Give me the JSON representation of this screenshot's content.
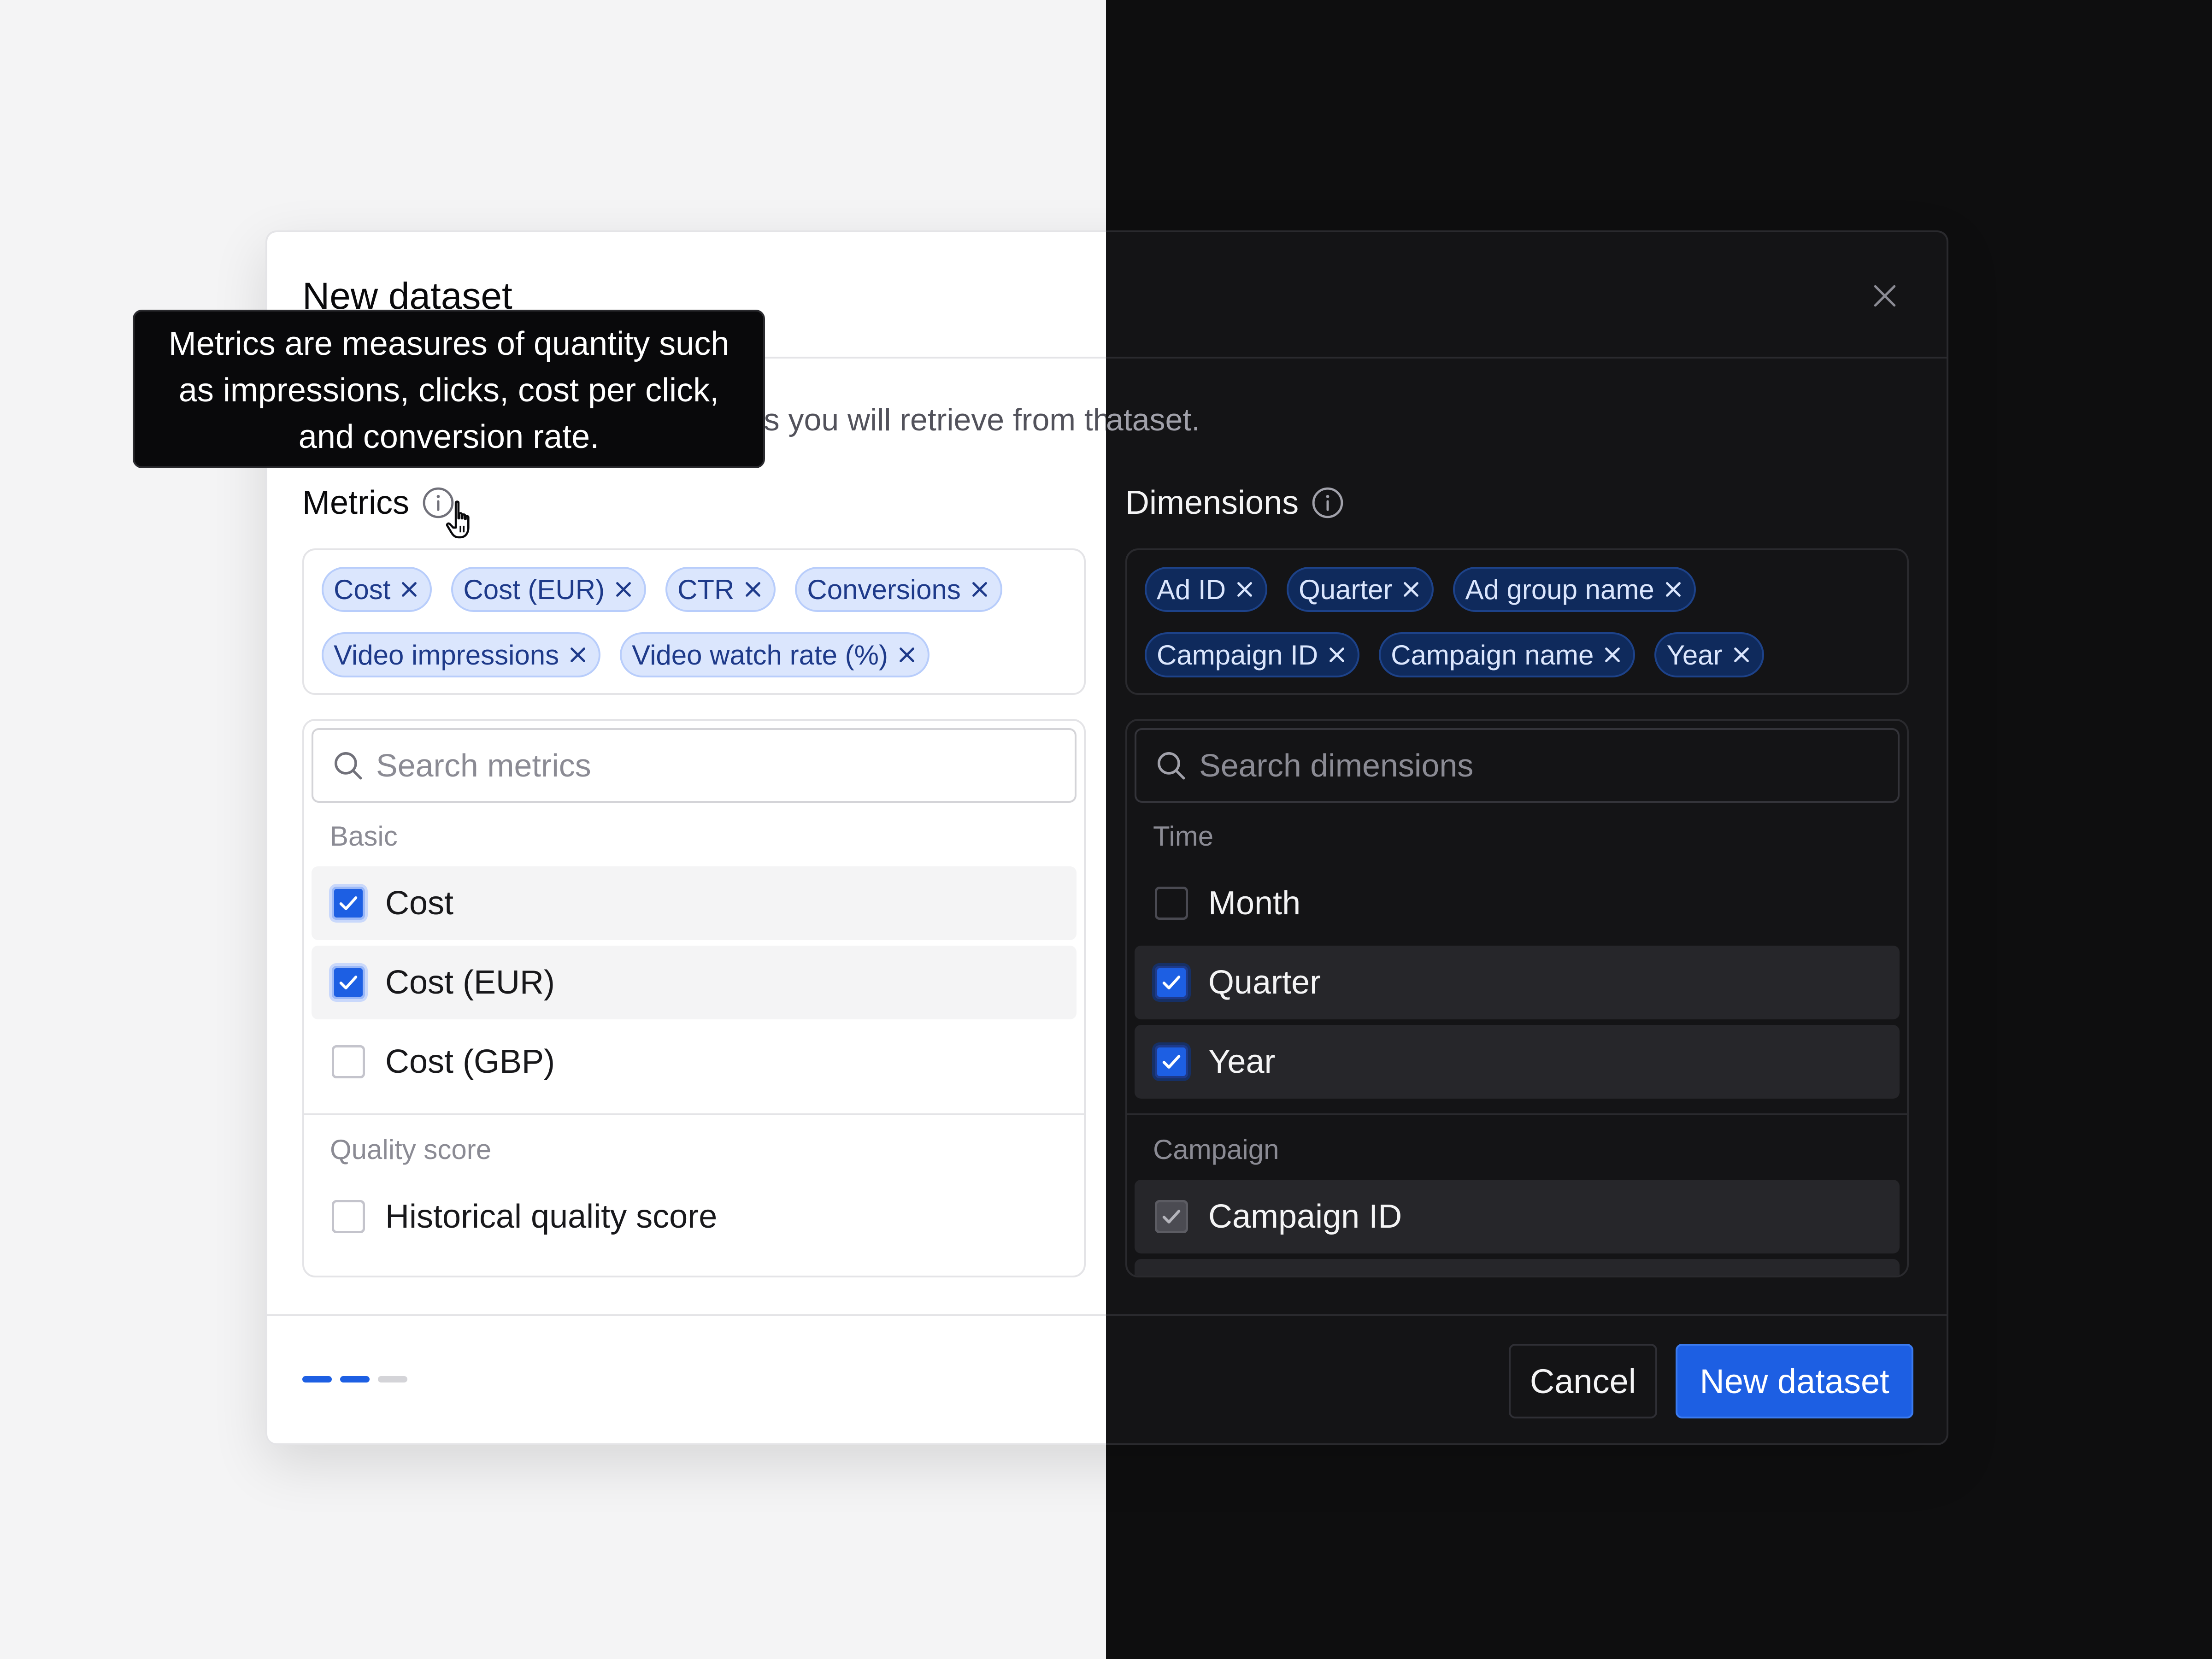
{
  "modal": {
    "title": "New dataset",
    "subtitle_left": "Select the metrics and dimensions you will retrieve from the dataset.",
    "subtitle_right": "ataset."
  },
  "tooltip": {
    "text": "Metrics are measures of quantity such as impressions, clicks, cost per click, and conversion rate."
  },
  "metrics": {
    "label": "Metrics",
    "chips": [
      "Cost",
      "Cost (EUR)",
      "CTR",
      "Conversions",
      "Video impressions",
      "Video watch rate (%)"
    ],
    "search_placeholder": "Search metrics",
    "groups": [
      {
        "label": "Basic",
        "options": [
          {
            "label": "Cost",
            "checked": true
          },
          {
            "label": "Cost (EUR)",
            "checked": true
          },
          {
            "label": "Cost (GBP)",
            "checked": false
          }
        ]
      },
      {
        "label": "Quality score",
        "options": [
          {
            "label": "Historical quality score",
            "checked": false
          }
        ]
      }
    ]
  },
  "dimensions": {
    "label": "Dimensions",
    "chips": [
      "Ad ID",
      "Quarter",
      "Ad group name",
      "Campaign ID",
      "Campaign name",
      "Year"
    ],
    "search_placeholder": "Search dimensions",
    "groups": [
      {
        "label": "Time",
        "options": [
          {
            "label": "Month",
            "checked": false
          },
          {
            "label": "Quarter",
            "checked": true
          },
          {
            "label": "Year",
            "checked": true
          }
        ]
      },
      {
        "label": "Campaign",
        "options": [
          {
            "label": "Campaign ID",
            "checked": true,
            "disabled": true
          }
        ]
      }
    ]
  },
  "footer": {
    "steps_total": 3,
    "steps_completed": 2,
    "cancel_label": "Cancel",
    "submit_label": "New dataset"
  },
  "colors": {
    "accent": "#1d5fe3",
    "light_bg": "#f4f4f5",
    "dark_bg": "#0e0e0f"
  },
  "icons": {
    "close": "close-icon",
    "info": "info-icon",
    "search": "search-icon",
    "check": "check-icon",
    "cursor": "hand-pointer-icon"
  }
}
